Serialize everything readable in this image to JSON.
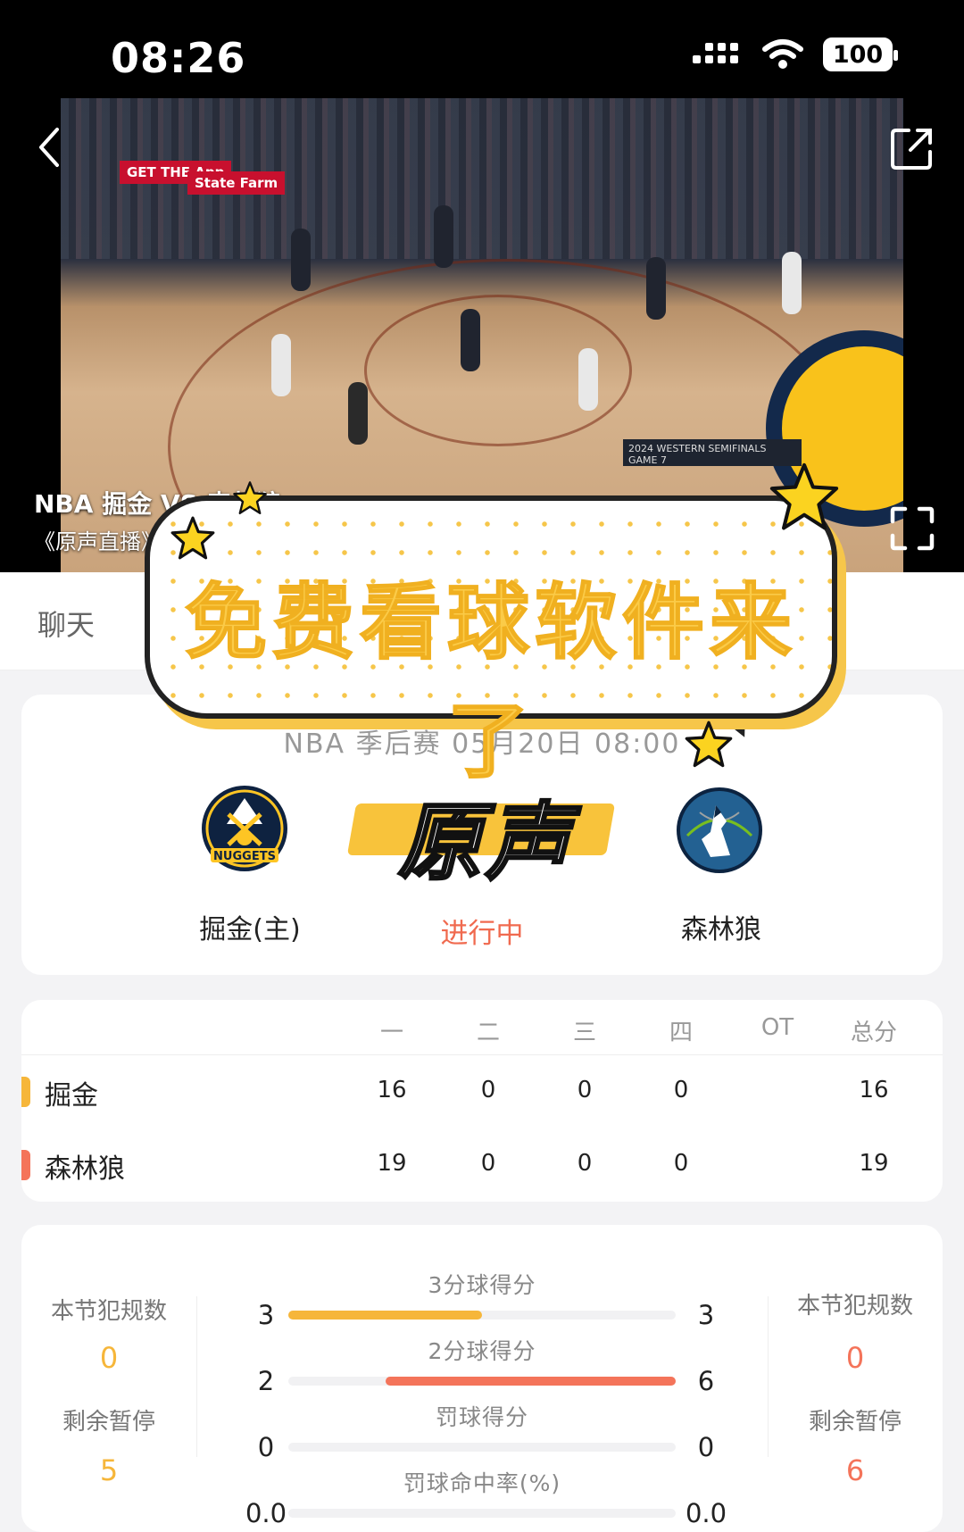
{
  "status_bar": {
    "time": "08:26",
    "battery": "100"
  },
  "video": {
    "title": "NBA 掘金 VS 森林狼",
    "subtitle": "《原声直播》",
    "ad_text_1": "GET THE App",
    "ad_text_2": "State Farm",
    "scoreboard_text": "2024 WESTERN SEMIFINALS GAME 7"
  },
  "tabs": {
    "chat": "聊天"
  },
  "promo": {
    "headline": "免费看球软件来了",
    "badge": "原声"
  },
  "match": {
    "info": "NBA 季后赛 05月20日 08:00",
    "home_name": "掘金(主)",
    "away_name": "森林狼",
    "status": "进行中",
    "home_logo_text": "NUGGETS"
  },
  "score_table": {
    "headers": [
      "一",
      "二",
      "三",
      "四",
      "OT",
      "总分"
    ],
    "rows": [
      {
        "team": "掘金",
        "color": "#f6b63a",
        "scores": [
          "16",
          "0",
          "0",
          "0",
          "",
          "16"
        ]
      },
      {
        "team": "森林狼",
        "color": "#f4745a",
        "scores": [
          "19",
          "0",
          "0",
          "0",
          "",
          "19"
        ]
      }
    ]
  },
  "stats": {
    "home_side": {
      "fouls_label": "本节犯规数",
      "fouls": "0",
      "timeouts_label": "剩余暂停",
      "timeouts": "5",
      "color": "#f6b63a"
    },
    "away_side": {
      "fouls_label": "本节犯规数",
      "fouls": "0",
      "timeouts_label": "剩余暂停",
      "timeouts": "6",
      "color": "#f4745a"
    },
    "rows": [
      {
        "label": "3分球得分",
        "home": "3",
        "away": "3",
        "home_share": 0.5,
        "away_share": 0.0
      },
      {
        "label": "2分球得分",
        "home": "2",
        "away": "6",
        "home_share": 0.0,
        "away_share": 0.75
      },
      {
        "label": "罚球得分",
        "home": "0",
        "away": "0",
        "home_share": 0.0,
        "away_share": 0.0
      },
      {
        "label": "罚球命中率(%)",
        "home": "0.0",
        "away": "0.0",
        "home_share": 0.0,
        "away_share": 0.0
      }
    ]
  }
}
